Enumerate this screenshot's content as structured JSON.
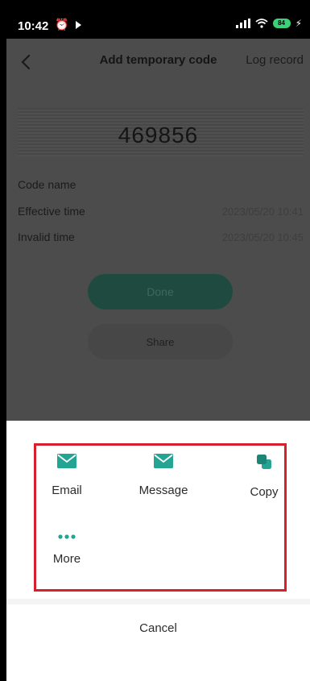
{
  "status_bar": {
    "time": "10:42",
    "alarm_icon": "alarm-icon",
    "play_icon": "play-icon",
    "battery_level": "84"
  },
  "header": {
    "title": "Add temporary code",
    "log_record_label": "Log record"
  },
  "code": {
    "value": "469856"
  },
  "details": {
    "code_name_label": "Code name",
    "effective_time_label": "Effective time",
    "effective_time_value": "2023/05/20 10:41",
    "invalid_time_label": "Invalid time",
    "invalid_time_value": "2023/05/20 10:45"
  },
  "actions": {
    "done_label": "Done",
    "share_label": "Share"
  },
  "share_sheet": {
    "items": [
      {
        "label": "Email",
        "icon": "email-icon"
      },
      {
        "label": "Message",
        "icon": "message-icon"
      },
      {
        "label": "Copy",
        "icon": "copy-icon"
      },
      {
        "label": "More",
        "icon": "more-icon"
      }
    ],
    "cancel_label": "Cancel"
  },
  "colors": {
    "accent": "#24a593",
    "highlight_border": "#d6202c",
    "overlay": "#4c4c4c"
  }
}
